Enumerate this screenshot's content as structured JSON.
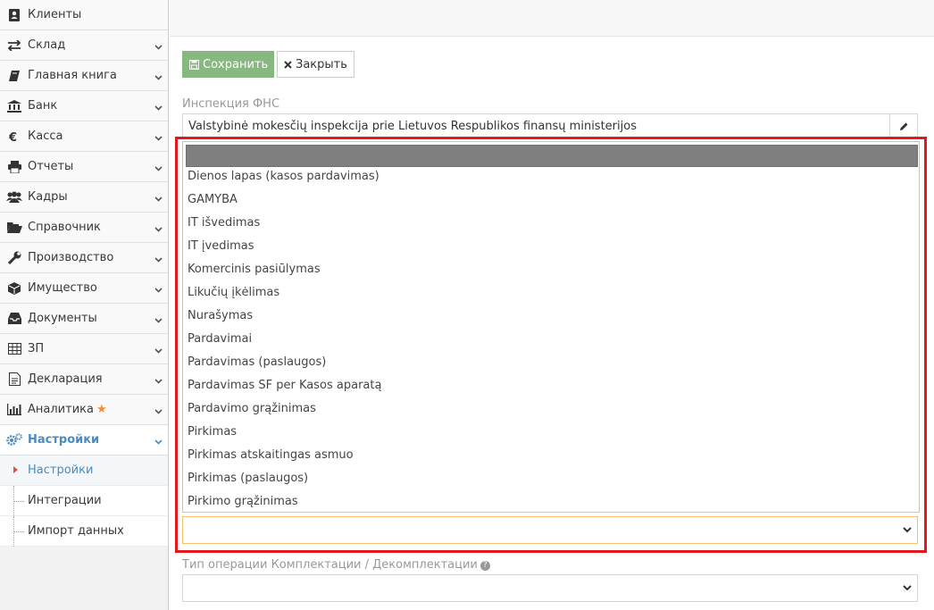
{
  "sidebar": {
    "items": [
      {
        "label": "Клиенты",
        "icon": "address-book-icon",
        "chevron": false
      },
      {
        "label": "Склад",
        "icon": "exchange-icon",
        "chevron": true
      },
      {
        "label": "Главная книга",
        "icon": "book-icon",
        "chevron": true
      },
      {
        "label": "Банк",
        "icon": "bank-icon",
        "chevron": true
      },
      {
        "label": "Касса",
        "icon": "euro-icon",
        "chevron": true
      },
      {
        "label": "Отчеты",
        "icon": "print-icon",
        "chevron": true
      },
      {
        "label": "Кадры",
        "icon": "users-icon",
        "chevron": true
      },
      {
        "label": "Справочник",
        "icon": "folder-open-icon",
        "chevron": true
      },
      {
        "label": "Производство",
        "icon": "wrench-icon",
        "chevron": true
      },
      {
        "label": "Имущество",
        "icon": "cube-icon",
        "chevron": true
      },
      {
        "label": "Документы",
        "icon": "inbox-icon",
        "chevron": true
      },
      {
        "label": "ЗП",
        "icon": "table-icon",
        "chevron": true
      },
      {
        "label": "Декларация",
        "icon": "file-text-icon",
        "chevron": true
      },
      {
        "label": "Аналитика",
        "icon": "bar-chart-icon",
        "chevron": true,
        "star": "★"
      },
      {
        "label": "Настройки",
        "icon": "cogs-icon",
        "chevron": true,
        "active": true
      }
    ],
    "subitems": [
      {
        "label": "Настройки",
        "current": true
      },
      {
        "label": "Интеграции"
      },
      {
        "label": "Импорт данных"
      }
    ]
  },
  "toolbar": {
    "save_label": "Сохранить",
    "close_label": "Закрыть"
  },
  "form": {
    "inspection_label": "Инспекция ФНС",
    "inspection_value": "Valstybinė mokesčių inspekcija prie Lietuvos Respublikos finansų ministerijos",
    "dropdown_options": [
      "Dienos lapas (kasos pardavimas)",
      "GAMYBA",
      "IT išvedimas",
      "IT įvedimas",
      "Komercinis pasiūlymas",
      "Likučių įkėlimas",
      "Nurašymas",
      "Pardavimai",
      "Pardavimas (paslaugos)",
      "Pardavimas SF per Kasos aparatą",
      "Pardavimo grąžinimas",
      "Pirkimas",
      "Pirkimas atskaitingas asmuo",
      "Pirkimas (paslaugos)",
      "Pirkimo grąžinimas"
    ],
    "kit_label": "Тип операции Комплектации / Декомплектации",
    "help_glyph": "?"
  },
  "colors": {
    "accent": "#4a8bc2",
    "save": "#87b87f",
    "highlight": "#e2181d",
    "focus_border": "#f5c074"
  }
}
